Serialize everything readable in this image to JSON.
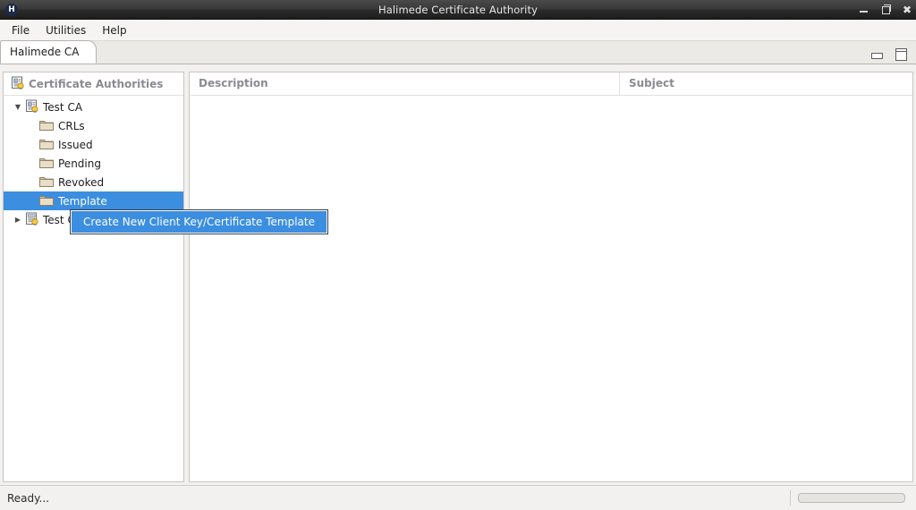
{
  "window": {
    "title": "Halimede Certificate Authority",
    "app_badge": "H",
    "controls": [
      {
        "name": "minimize",
        "glyph": ""
      },
      {
        "name": "maximize",
        "glyph": ""
      },
      {
        "name": "close",
        "glyph": "✖"
      }
    ]
  },
  "menubar": {
    "items": [
      {
        "label": "File"
      },
      {
        "label": "Utilities"
      },
      {
        "label": "Help"
      }
    ]
  },
  "tabs": {
    "items": [
      {
        "label": "Halimede CA",
        "active": true
      }
    ],
    "tools": [
      {
        "name": "minimize-view",
        "icon": "minimize-icon"
      },
      {
        "name": "maximize-view",
        "icon": "maximize-icon"
      }
    ]
  },
  "tree_panel": {
    "header": {
      "icon": "certificate-authority-icon",
      "title": "Certificate Authorities"
    },
    "rows": [
      {
        "label": "Test CA",
        "level": 1,
        "icon": "certificate-authority-icon",
        "twisty": "▼",
        "selected": false
      },
      {
        "label": "CRLs",
        "level": 2,
        "icon": "folder-icon",
        "twisty": "",
        "selected": false
      },
      {
        "label": "Issued",
        "level": 2,
        "icon": "folder-icon",
        "twisty": "",
        "selected": false
      },
      {
        "label": "Pending",
        "level": 2,
        "icon": "folder-icon",
        "twisty": "",
        "selected": false
      },
      {
        "label": "Revoked",
        "level": 2,
        "icon": "folder-icon",
        "twisty": "",
        "selected": false
      },
      {
        "label": "Template",
        "level": 2,
        "icon": "folder-icon",
        "twisty": "",
        "selected": true
      },
      {
        "label": "Test CA",
        "level": 1,
        "icon": "certificate-authority-locked-icon",
        "twisty": "▶",
        "selected": false
      }
    ]
  },
  "list_panel": {
    "columns": [
      {
        "label": "Description"
      },
      {
        "label": "Subject"
      }
    ],
    "rows": []
  },
  "context_menu": {
    "items": [
      {
        "label": "Create New Client Key/Certificate Template",
        "highlighted": true
      }
    ]
  },
  "statusbar": {
    "text": "Ready...",
    "progress_label": ""
  },
  "colors": {
    "selection": "#3b8ee0",
    "titlebar": "#2b2b2b",
    "panel_bg": "#ffffff",
    "chrome_bg": "#f2f1f0",
    "header_text": "#8a8a92"
  }
}
